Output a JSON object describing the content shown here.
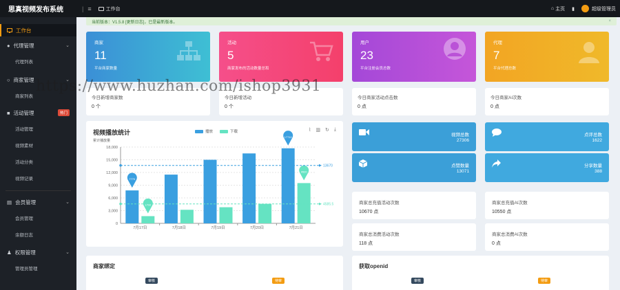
{
  "app": {
    "title": "思真视频发布系统",
    "tab": "工作台"
  },
  "topbar": {
    "home": "主页",
    "admin": "超级管理员"
  },
  "sidebar": {
    "items": [
      {
        "label": "工作台"
      },
      {
        "label": "代理管理",
        "subs": [
          "代理列表"
        ]
      },
      {
        "label": "商家管理",
        "subs": [
          "商家列表"
        ]
      },
      {
        "label": "活动管理",
        "badge": "热门",
        "subs": [
          "活动管理",
          "视频素材",
          "活动分类",
          "视频记录"
        ]
      },
      {
        "label": "会员管理",
        "subs": [
          "会员管理",
          "余额日志"
        ]
      },
      {
        "label": "权限管理",
        "subs": [
          "管理员管理"
        ]
      }
    ]
  },
  "alert": {
    "text": "当前版本：V1.5.8 [更新日志]，已是最新版本。",
    "close": "×"
  },
  "stats": [
    {
      "label": "商家",
      "value": "11",
      "sub": "平台商家数量",
      "color": "#3bb0d6",
      "icon": "sitemap-icon"
    },
    {
      "label": "活动",
      "value": "5",
      "sub": "商家发布的活动数量总和",
      "color": "#f44a7d",
      "icon": "cart-icon"
    },
    {
      "label": "用户",
      "value": "23",
      "sub": "平台注册会员总数",
      "color": "#b14fd6",
      "icon": "user-circle-icon"
    },
    {
      "label": "代理",
      "value": "7",
      "sub": "平台代理总数",
      "color": "#f3a623",
      "icon": "user-icon"
    }
  ],
  "minis": [
    {
      "t": "今日新增商家数",
      "v": "0 个"
    },
    {
      "t": "今日新增活动",
      "v": "0 个"
    },
    {
      "t": "今日商家活动点击数",
      "v": "0 点"
    },
    {
      "t": "今日商家AI次数",
      "v": "0 点"
    }
  ],
  "chart_data": {
    "type": "bar",
    "title": "视频播放统计",
    "ylabel": "累计播放量",
    "categories": [
      "7月17日",
      "7月18日",
      "7月19日",
      "7月20日",
      "7月21日"
    ],
    "ylim": [
      0,
      18000
    ],
    "yticks": [
      "18,000",
      "15,000",
      "12,000",
      "9,000",
      "6,000",
      "3,000",
      "0"
    ],
    "series": [
      {
        "name": "播放",
        "color": "#3a9fe0",
        "values": [
          7770,
          11500,
          15000,
          16500,
          17710
        ],
        "labels": [
          "7770",
          "",
          "",
          "",
          "17710"
        ]
      },
      {
        "name": "下载",
        "color": "#65e3c2",
        "values": [
          1700,
          3200,
          3800,
          4600,
          9500
        ],
        "labels": [
          "1700",
          "",
          "",
          "",
          "9520"
        ]
      }
    ],
    "markline": [
      {
        "value": 13670,
        "label": "13670"
      },
      {
        "value": 4585.5,
        "label": "4585.5"
      }
    ]
  },
  "tiles": [
    {
      "label": "视频总数",
      "value": "27306",
      "color": "#3b9fd8",
      "icon": "video-icon"
    },
    {
      "label": "点评总数",
      "value": "1622",
      "color": "#40a9df",
      "icon": "comment-icon"
    },
    {
      "label": "点赞数量",
      "value": "13071",
      "color": "#3b9fd8",
      "icon": "cube-icon"
    },
    {
      "label": "分享数量",
      "value": "388",
      "color": "#40a9df",
      "icon": "share-icon"
    }
  ],
  "infos": [
    {
      "t": "商家总充值活动次数",
      "v": "10670 点"
    },
    {
      "t": "商家总充值AI次数",
      "v": "10550 点"
    },
    {
      "t": "商家总消费活动次数",
      "v": "118 点"
    },
    {
      "t": "商家总消费AI次数",
      "v": "0 点"
    }
  ],
  "panels": [
    {
      "title": "商家绑定",
      "badges": [
        "审核",
        "待审"
      ]
    },
    {
      "title": "获取openid",
      "badges": [
        "审核",
        "待审"
      ]
    }
  ],
  "watermark": "https://www.huzhan.com/ishop3931"
}
